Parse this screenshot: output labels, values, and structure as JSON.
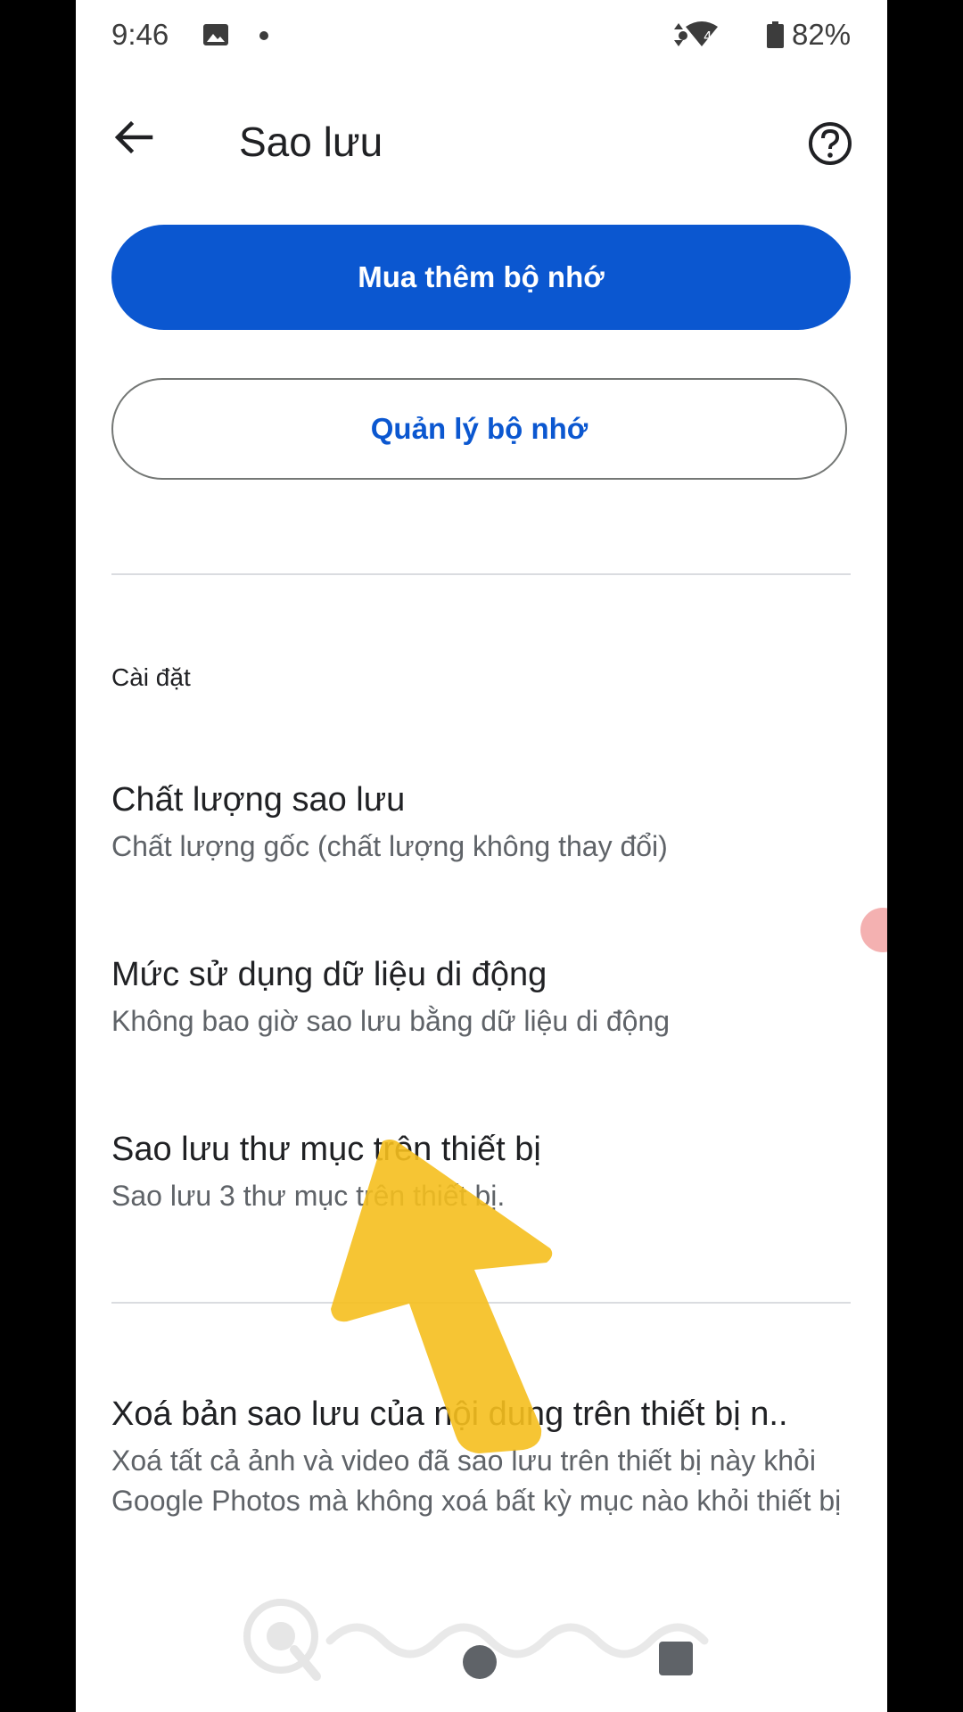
{
  "status_bar": {
    "time": "9:46",
    "network_badge": "4",
    "battery": "82%"
  },
  "app_bar": {
    "title": "Sao lưu"
  },
  "buttons": {
    "buy_storage": "Mua thêm bộ nhớ",
    "manage_storage": "Quản lý bộ nhớ"
  },
  "settings": {
    "header": "Cài đặt",
    "items": [
      {
        "title": "Chất lượng sao lưu",
        "subtitle": "Chất lượng gốc (chất lượng không thay đổi)"
      },
      {
        "title": "Mức sử dụng dữ liệu di động",
        "subtitle": "Không bao giờ sao lưu bằng dữ liệu di động"
      },
      {
        "title": "Sao lưu thư mục trên thiết bị",
        "subtitle": "Sao lưu 3 thư mục trên thiết bị."
      },
      {
        "title": "Xoá bản sao lưu của nội dung trên thiết bị n..",
        "subtitle": "Xoá tất cả ảnh và video đã sao lưu trên thiết bị này khỏi Google Photos mà không xoá bất kỳ mục nào khỏi thiết bị"
      }
    ]
  },
  "colors": {
    "primary": "#0b57d0",
    "arrow": "#f5bf1e"
  }
}
